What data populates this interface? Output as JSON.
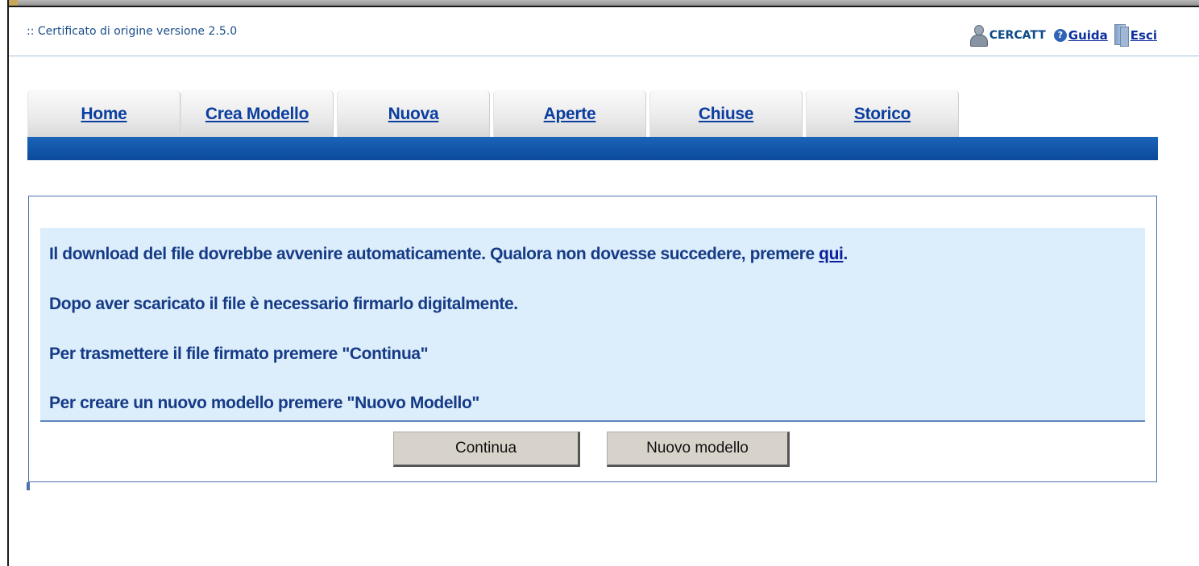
{
  "header": {
    "app_title": ":: Certificato di origine versione 2.5.0",
    "user_name": "CERCATT",
    "help_label": "Guida",
    "exit_label": "Esci"
  },
  "tabs": [
    {
      "label": "Home"
    },
    {
      "label": "Crea Modello"
    },
    {
      "label": "Nuova"
    },
    {
      "label": "Aperte"
    },
    {
      "label": "Chiuse"
    },
    {
      "label": "Storico"
    }
  ],
  "messages": {
    "download_text": "Il download del file dovrebbe avvenire automaticamente. Qualora non dovesse succedere, premere ",
    "download_link": "qui",
    "download_end": ".",
    "sign_text": "Dopo aver scaricato il file è necessario firmarlo digitalmente.",
    "continue_text": "Per trasmettere il file firmato premere \"Continua\"",
    "new_model_text": "Per creare un nuovo modello premere \"Nuovo Modello\""
  },
  "buttons": {
    "continue_label": "Continua",
    "new_model_label": "Nuovo modello"
  },
  "colors": {
    "tab_bar": "#0c4a9b",
    "info_background": "#dcedfb",
    "link": "#0b2fa0"
  },
  "icons": {
    "user": "user-icon",
    "help": "help-icon",
    "exit": "door-icon"
  }
}
